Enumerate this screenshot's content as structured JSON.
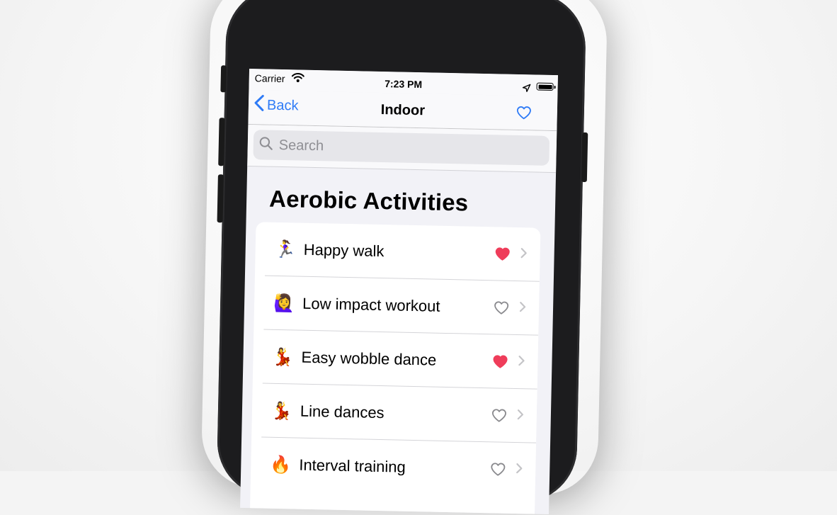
{
  "status_bar": {
    "carrier": "Carrier",
    "time": "7:23 PM"
  },
  "nav": {
    "back_label": "Back",
    "title": "Indoor"
  },
  "search": {
    "placeholder": "Search",
    "value": ""
  },
  "section": {
    "title": "Aerobic Activities"
  },
  "activities": [
    {
      "emoji": "🏃‍♀️",
      "label": "Happy walk",
      "favorite": true
    },
    {
      "emoji": "🙋‍♀️",
      "label": "Low impact workout",
      "favorite": false
    },
    {
      "emoji": "💃",
      "label": "Easy wobble dance",
      "favorite": true
    },
    {
      "emoji": "💃",
      "label": "Line dances",
      "favorite": false
    },
    {
      "emoji": "🔥",
      "label": "Interval training",
      "favorite": false
    }
  ],
  "colors": {
    "accent": "#2f7bf6",
    "heart_filled": "#ef3d5a",
    "heart_outline": "#8a8a8e",
    "chevron": "#c4c4c7"
  },
  "icons": {
    "back": "chevron-left-icon",
    "favorites": "heart-outline-icon",
    "search": "magnifier-icon",
    "row_chevron": "chevron-right-icon"
  }
}
